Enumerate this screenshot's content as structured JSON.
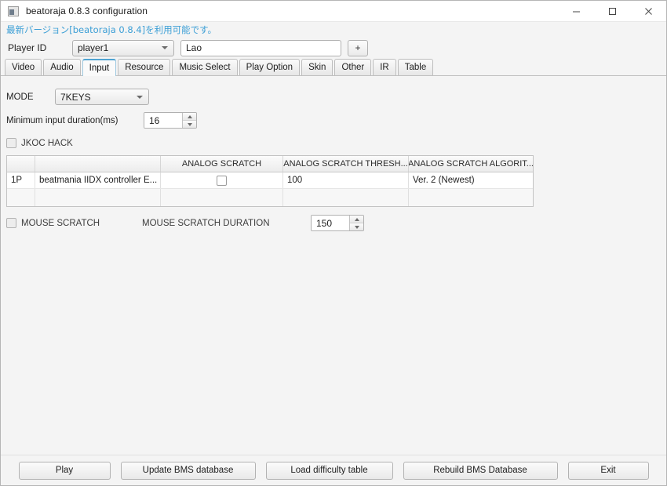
{
  "window": {
    "title": "beatoraja 0.8.3 configuration",
    "icon": "app-icon",
    "controls": {
      "minimize": "minimize-icon",
      "maximize": "maximize-icon",
      "close": "close-icon"
    }
  },
  "update_notice": {
    "text": "最新バージョン[beatoraja 0.8.4]を利用可能です。",
    "color": "#3c9fd6"
  },
  "player_row": {
    "label": "Player ID",
    "selected_profile": "player1",
    "profile_options": [
      "player1"
    ],
    "name_value": "Lao",
    "name_placeholder": "",
    "add_label": "+"
  },
  "tabs": [
    {
      "label": "Video",
      "selected": false
    },
    {
      "label": "Audio",
      "selected": false
    },
    {
      "label": "Input",
      "selected": true
    },
    {
      "label": "Resource",
      "selected": false
    },
    {
      "label": "Music Select",
      "selected": false
    },
    {
      "label": "Play Option",
      "selected": false
    },
    {
      "label": "Skin",
      "selected": false
    },
    {
      "label": "Other",
      "selected": false
    },
    {
      "label": "IR",
      "selected": false
    },
    {
      "label": "Table",
      "selected": false
    }
  ],
  "input_tab": {
    "mode": {
      "label": "MODE",
      "value": "7KEYS",
      "options": [
        "7KEYS"
      ]
    },
    "min_input_duration": {
      "label": "Minimum input duration(ms)",
      "value": "16"
    },
    "jkoc_hack": {
      "label": "JKOC HACK",
      "checked": false
    },
    "table": {
      "headers": [
        "",
        "",
        "ANALOG SCRATCH",
        "ANALOG SCRATCH THRESH...",
        "ANALOG SCRATCH ALGORIT..."
      ],
      "rows": [
        {
          "player": "1P",
          "device": "beatmania IIDX controller E...",
          "analog_scratch": false,
          "threshold": "100",
          "algorithm": "Ver. 2 (Newest)"
        }
      ],
      "empty_row": true
    },
    "mouse_scratch": {
      "label": "MOUSE SCRATCH",
      "checked": false,
      "duration_label": "MOUSE SCRATCH DURATION",
      "duration_value": "150"
    }
  },
  "bottom_buttons": {
    "play": "Play",
    "update_bms": "Update BMS database",
    "load_table": "Load difficulty table",
    "rebuild_bms": "Rebuild BMS Database",
    "exit": "Exit"
  }
}
